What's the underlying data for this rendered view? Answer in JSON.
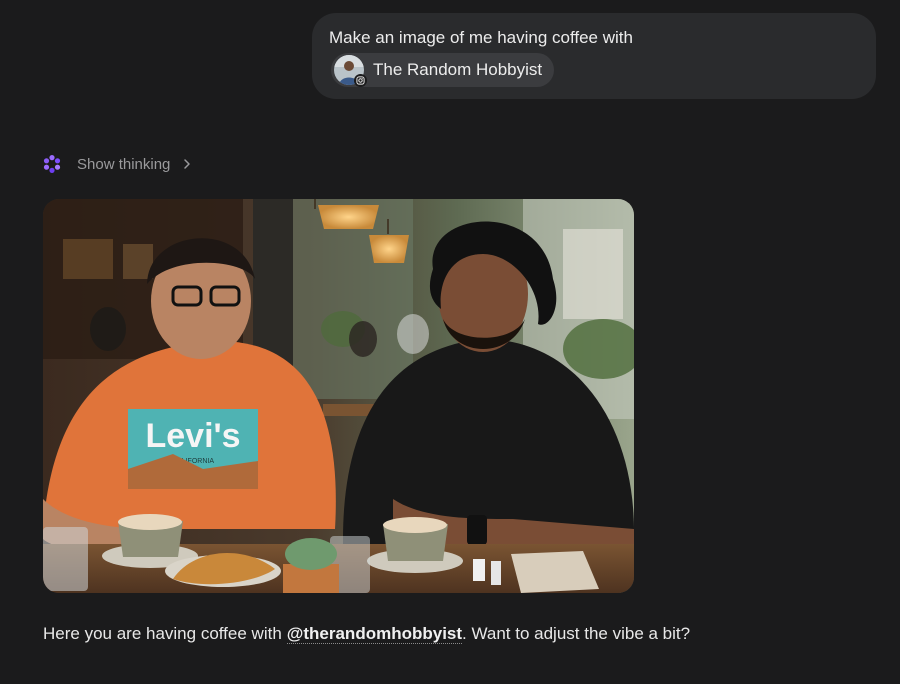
{
  "user_message": {
    "text": "Make an image of me having coffee with",
    "mention": {
      "name": "The Random Hobbyist",
      "platform_icon": "instagram-icon"
    }
  },
  "thinking": {
    "label": "Show thinking",
    "icon": "sparkle-icon"
  },
  "generated_image": {
    "alt": "",
    "shirt_print": "Levi's",
    "shirt_subprint": "CALIFORNIA"
  },
  "response": {
    "prefix": "Here you are having coffee with",
    "handle": "@therandomhobbyist",
    "suffix": ". Want to adjust the vibe a bit?"
  },
  "colors": {
    "background": "#1b1b1c",
    "bubble": "#2a2b2d",
    "chip": "#3b3c3f",
    "sparkle": "#8b5cf6"
  }
}
